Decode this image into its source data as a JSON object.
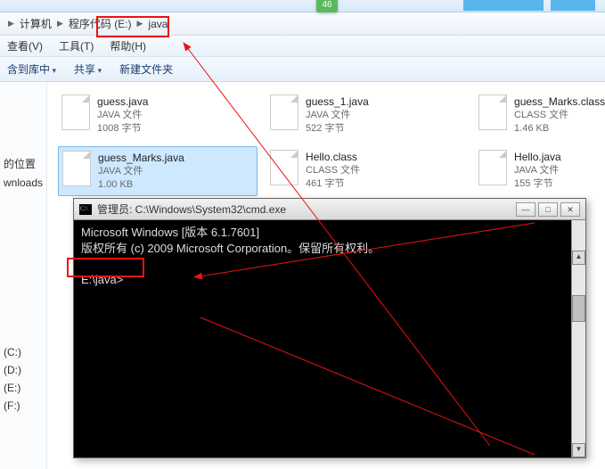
{
  "tabs": {
    "badge": "46"
  },
  "breadcrumb": {
    "seg1": "计算机",
    "seg2": "程序代码 (E:)",
    "seg3": "java"
  },
  "menu": {
    "view": "查看(V)",
    "tools": "工具(T)",
    "help": "帮助(H)"
  },
  "toolbar": {
    "include": "含到库中",
    "share": "共享",
    "newfolder": "新建文件夹"
  },
  "sidebar": {
    "loc": "的位置",
    "dl": "wnloads",
    "drives": [
      "(C:)",
      "(D:)",
      "(E:)",
      "(F:)"
    ]
  },
  "files": [
    [
      {
        "name": "guess.java",
        "type": "JAVA 文件",
        "size": "1008 字节"
      },
      {
        "name": "guess_1.java",
        "type": "JAVA 文件",
        "size": "522 字节"
      },
      {
        "name": "guess_Marks.class",
        "type": "CLASS 文件",
        "size": "1.46 KB"
      }
    ],
    [
      {
        "name": "guess_Marks.java",
        "type": "JAVA 文件",
        "size": "1.00 KB",
        "sel": true
      },
      {
        "name": "Hello.class",
        "type": "CLASS 文件",
        "size": "461 字节"
      },
      {
        "name": "Hello.java",
        "type": "JAVA 文件",
        "size": "155 字节"
      }
    ]
  ],
  "cmd": {
    "title": "管理员: C:\\Windows\\System32\\cmd.exe",
    "line1": "Microsoft Windows [版本 6.1.7601]",
    "line2": "版权所有 (c) 2009 Microsoft Corporation。保留所有权利。",
    "prompt": "E:\\java>"
  }
}
